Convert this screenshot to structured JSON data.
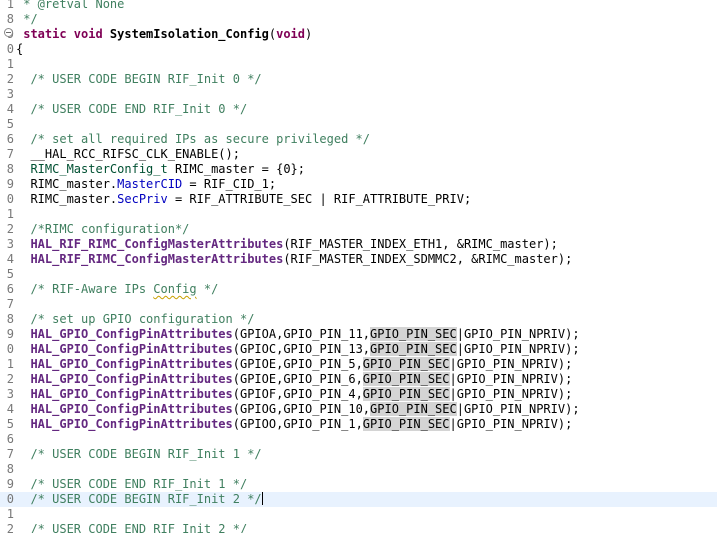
{
  "editor": {
    "lines": [
      {
        "num": "1",
        "tokens": [
          {
            "t": " * @retval None",
            "c": "comment"
          }
        ]
      },
      {
        "num": "8",
        "tokens": [
          {
            "t": " */",
            "c": "comment"
          }
        ]
      },
      {
        "num": "9",
        "fold": true,
        "tokens": [
          {
            "t": " static ",
            "c": "keyword"
          },
          {
            "t": "void ",
            "c": "keyword"
          },
          {
            "t": "SystemIsolation_Config",
            "c": "func"
          },
          {
            "t": "(",
            "c": "plain"
          },
          {
            "t": "void",
            "c": "keyword"
          },
          {
            "t": ")",
            "c": "plain"
          }
        ]
      },
      {
        "num": "0",
        "tokens": [
          {
            "t": "{",
            "c": "plain"
          }
        ]
      },
      {
        "num": "1",
        "tokens": []
      },
      {
        "num": "2",
        "tokens": [
          {
            "t": "  /* USER CODE BEGIN RIF_Init 0 */",
            "c": "comment"
          }
        ]
      },
      {
        "num": "3",
        "tokens": []
      },
      {
        "num": "4",
        "tokens": [
          {
            "t": "  /* USER CODE END RIF_Init 0 */",
            "c": "comment"
          }
        ]
      },
      {
        "num": "5",
        "tokens": []
      },
      {
        "num": "6",
        "tokens": [
          {
            "t": "  /* set all required IPs as secure privileged */",
            "c": "comment"
          }
        ]
      },
      {
        "num": "7",
        "tokens": [
          {
            "t": "  __HAL_RCC_RIFSC_CLK_ENABLE();",
            "c": "plain"
          }
        ]
      },
      {
        "num": "8",
        "tokens": [
          {
            "t": "  ",
            "c": "plain"
          },
          {
            "t": "RIMC_MasterConfig_t",
            "c": "type"
          },
          {
            "t": " RIMC_master = {0};",
            "c": "plain"
          }
        ]
      },
      {
        "num": "9",
        "tokens": [
          {
            "t": "  RIMC_master.",
            "c": "plain"
          },
          {
            "t": "MasterCID",
            "c": "field"
          },
          {
            "t": " = RIF_CID_1;",
            "c": "plain"
          }
        ]
      },
      {
        "num": "0",
        "tokens": [
          {
            "t": "  RIMC_master.",
            "c": "plain"
          },
          {
            "t": "SecPriv",
            "c": "field"
          },
          {
            "t": " = RIF_ATTRIBUTE_SEC | RIF_ATTRIBUTE_PRIV;",
            "c": "plain"
          }
        ]
      },
      {
        "num": "1",
        "tokens": []
      },
      {
        "num": "2",
        "tokens": [
          {
            "t": "  /*RIMC configuration*/",
            "c": "comment"
          }
        ]
      },
      {
        "num": "3",
        "tokens": [
          {
            "t": "  ",
            "c": "plain"
          },
          {
            "t": "HAL_RIF_RIMC_ConfigMasterAttributes",
            "c": "macrofunc"
          },
          {
            "t": "(RIF_MASTER_INDEX_ETH1, &RIMC_master);",
            "c": "plain"
          }
        ]
      },
      {
        "num": "4",
        "tokens": [
          {
            "t": "  ",
            "c": "plain"
          },
          {
            "t": "HAL_RIF_RIMC_ConfigMasterAttributes",
            "c": "macrofunc"
          },
          {
            "t": "(RIF_MASTER_INDEX_SDMMC2, &RIMC_master);",
            "c": "plain"
          }
        ]
      },
      {
        "num": "5",
        "tokens": []
      },
      {
        "num": "6",
        "tokens": [
          {
            "t": "  /* RIF-Aware IPs ",
            "c": "comment"
          },
          {
            "t": "Config",
            "c": "comment",
            "spell": true
          },
          {
            "t": " */",
            "c": "comment"
          }
        ]
      },
      {
        "num": "7",
        "tokens": []
      },
      {
        "num": "8",
        "tokens": [
          {
            "t": "  /* set up GPIO configuration */",
            "c": "comment"
          }
        ]
      },
      {
        "num": "9",
        "tokens": [
          {
            "t": "  ",
            "c": "plain"
          },
          {
            "t": "HAL_GPIO_ConfigPinAttributes",
            "c": "macrofunc"
          },
          {
            "t": "(GPIOA,GPIO_PIN_11,",
            "c": "plain"
          },
          {
            "t": "GPIO_PIN_SEC",
            "c": "plain",
            "hl": true
          },
          {
            "t": "|GPIO_PIN_NPRIV);",
            "c": "plain"
          }
        ]
      },
      {
        "num": "0",
        "tokens": [
          {
            "t": "  ",
            "c": "plain"
          },
          {
            "t": "HAL_GPIO_ConfigPinAttributes",
            "c": "macrofunc"
          },
          {
            "t": "(GPIOC,GPIO_PIN_13,",
            "c": "plain"
          },
          {
            "t": "GPIO_PIN_SEC",
            "c": "plain",
            "hl": true
          },
          {
            "t": "|GPIO_PIN_NPRIV);",
            "c": "plain"
          }
        ]
      },
      {
        "num": "1",
        "tokens": [
          {
            "t": "  ",
            "c": "plain"
          },
          {
            "t": "HAL_GPIO_ConfigPinAttributes",
            "c": "macrofunc"
          },
          {
            "t": "(GPIOE,GPIO_PIN_5,",
            "c": "plain"
          },
          {
            "t": "GPIO_PIN_SEC",
            "c": "plain",
            "hl": true
          },
          {
            "t": "|GPIO_PIN_NPRIV);",
            "c": "plain"
          }
        ]
      },
      {
        "num": "2",
        "tokens": [
          {
            "t": "  ",
            "c": "plain"
          },
          {
            "t": "HAL_GPIO_ConfigPinAttributes",
            "c": "macrofunc"
          },
          {
            "t": "(GPIOE,GPIO_PIN_6,",
            "c": "plain"
          },
          {
            "t": "GPIO_PIN_SEC",
            "c": "plain",
            "hl": true
          },
          {
            "t": "|GPIO_PIN_NPRIV);",
            "c": "plain"
          }
        ]
      },
      {
        "num": "3",
        "tokens": [
          {
            "t": "  ",
            "c": "plain"
          },
          {
            "t": "HAL_GPIO_ConfigPinAttributes",
            "c": "macrofunc"
          },
          {
            "t": "(GPIOF,GPIO_PIN_4,",
            "c": "plain"
          },
          {
            "t": "GPIO_PIN_SEC",
            "c": "plain",
            "hl": true
          },
          {
            "t": "|GPIO_PIN_NPRIV);",
            "c": "plain"
          }
        ]
      },
      {
        "num": "4",
        "tokens": [
          {
            "t": "  ",
            "c": "plain"
          },
          {
            "t": "HAL_GPIO_ConfigPinAttributes",
            "c": "macrofunc"
          },
          {
            "t": "(GPIOG,GPIO_PIN_10,",
            "c": "plain"
          },
          {
            "t": "GPIO_PIN_SEC",
            "c": "plain",
            "hl": true
          },
          {
            "t": "|GPIO_PIN_NPRIV);",
            "c": "plain"
          }
        ]
      },
      {
        "num": "5",
        "tokens": [
          {
            "t": "  ",
            "c": "plain"
          },
          {
            "t": "HAL_GPIO_ConfigPinAttributes",
            "c": "macrofunc"
          },
          {
            "t": "(GPIOO,GPIO_PIN_1,",
            "c": "plain"
          },
          {
            "t": "GPIO_PIN_SEC",
            "c": "plain",
            "hl": true
          },
          {
            "t": "|GPIO_PIN_NPRIV);",
            "c": "plain"
          }
        ]
      },
      {
        "num": "6",
        "tokens": []
      },
      {
        "num": "7",
        "tokens": [
          {
            "t": "  /* USER CODE BEGIN RIF_Init 1 */",
            "c": "comment"
          }
        ]
      },
      {
        "num": "8",
        "tokens": []
      },
      {
        "num": "9",
        "tokens": [
          {
            "t": "  /* USER CODE END RIF_Init 1 */",
            "c": "comment"
          }
        ]
      },
      {
        "num": "0",
        "current": true,
        "caret": true,
        "tokens": [
          {
            "t": "  /* USER CODE BEGIN RIF_Init 2 */",
            "c": "comment"
          }
        ]
      },
      {
        "num": "1",
        "tokens": []
      },
      {
        "num": "2",
        "tokens": [
          {
            "t": "  /* USER CODE END RIF_Init 2 */",
            "c": "comment"
          }
        ]
      }
    ]
  }
}
